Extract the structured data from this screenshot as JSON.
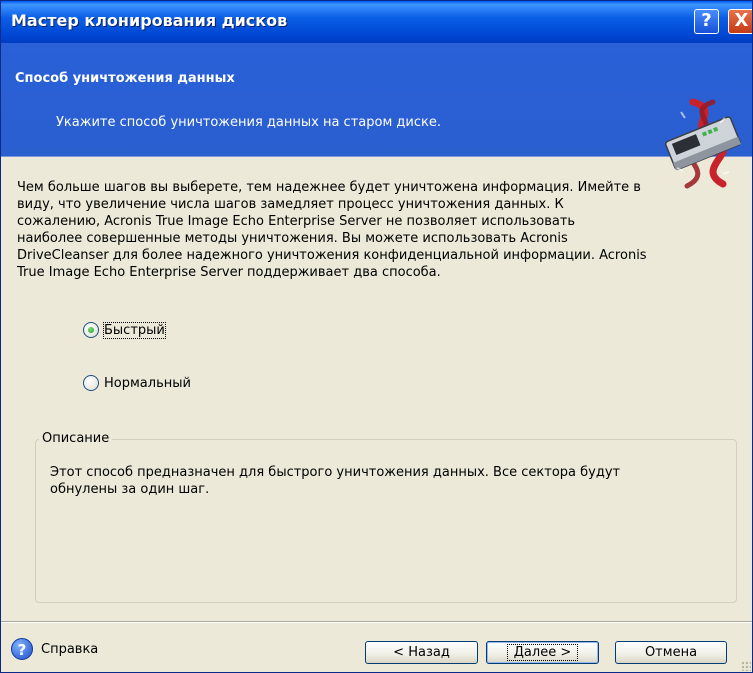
{
  "window": {
    "title": "Мастер клонирования дисков",
    "help_button": "?",
    "close_button": "X"
  },
  "header": {
    "title": "Способ уничтожения данных",
    "subtitle": "Укажите способ уничтожения данных на старом диске.",
    "icon": "disk-shred-icon"
  },
  "content": {
    "description_lines": [
      "Чем больше шагов вы выберете, тем надежнее будет уничтожена информация. Имейте в",
      "виду, что увеличение числа шагов замедляет процесс уничтожения данных. К",
      "сожалению, Acronis True Image Echo Enterprise Server не позволяет использовать",
      "наиболее совершенные методы уничтожения. Вы можете использовать Acronis",
      "DriveCleanser для более надежного уничтожения конфиденциальной информации. Acronis",
      "True Image Echo Enterprise Server поддерживает два способа."
    ],
    "options": [
      {
        "label": "Быстрый",
        "selected": true
      },
      {
        "label": "Нормальный",
        "selected": false
      }
    ],
    "group": {
      "legend": "Описание",
      "lines": [
        "Этот способ предназначен для быстрого уничтожения данных. Все сектора будут",
        "обнулены за один шаг."
      ]
    }
  },
  "footer": {
    "help_label": "Справка",
    "back_label": "< Назад",
    "next_label": "Далее >",
    "cancel_label": "Отмена"
  },
  "colors": {
    "title_bar": "#0058ee",
    "header_band": "#2a60d8",
    "dialog_face": "#ece9d8",
    "radio_dot": "#1e9e1c"
  }
}
